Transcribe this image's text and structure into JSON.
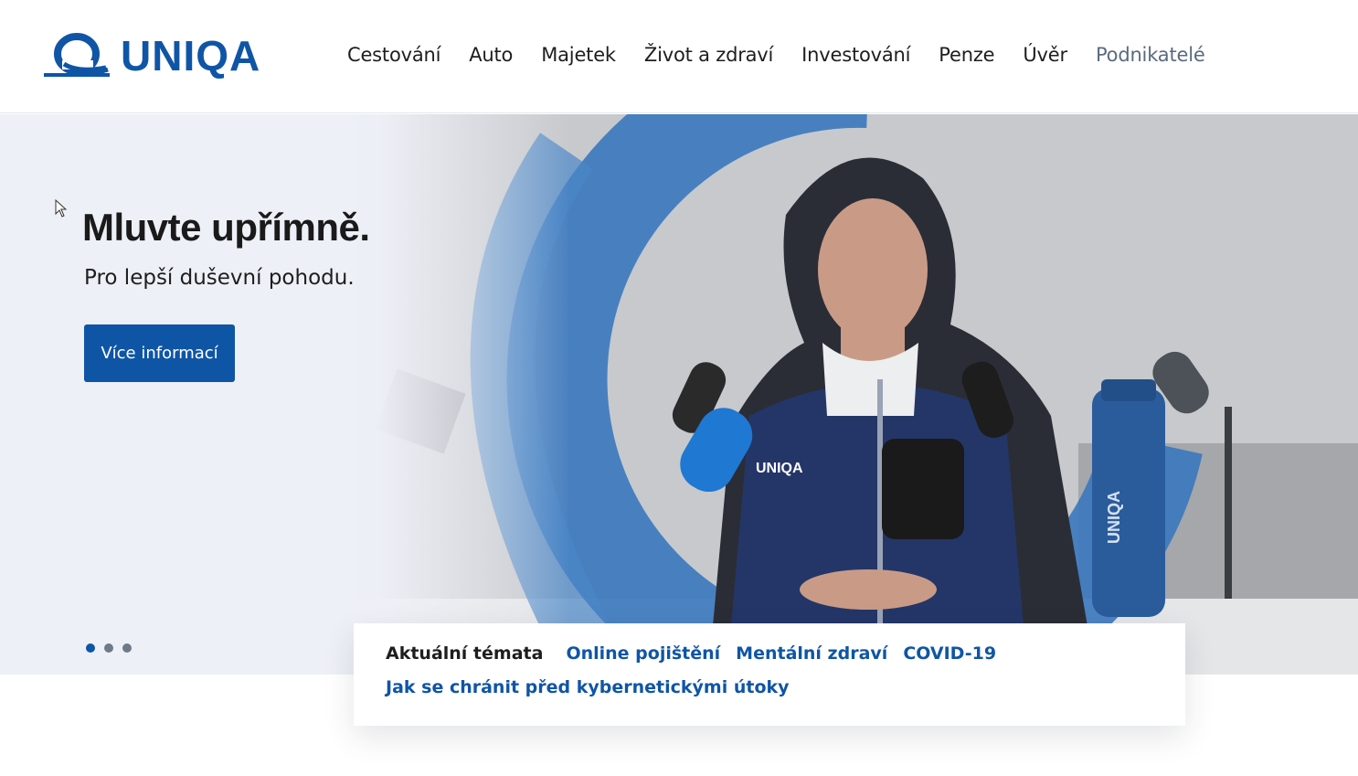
{
  "header": {
    "logo_text": "UNIQA",
    "nav": [
      {
        "label": "Cestování"
      },
      {
        "label": "Auto"
      },
      {
        "label": "Majetek"
      },
      {
        "label": "Život a zdraví"
      },
      {
        "label": "Investování"
      },
      {
        "label": "Penze"
      },
      {
        "label": "Úvěr"
      },
      {
        "label": "Podnikatelé"
      }
    ]
  },
  "hero": {
    "title": "Mluvte upřímně.",
    "subtitle": "Pro lepší duševní pohodu.",
    "button_label": "Více informací",
    "jacket_logo": "UNIQA",
    "bottle_logo": "UNIQA",
    "slides_total": 3,
    "active_slide": 1
  },
  "topics": {
    "label": "Aktuální témata",
    "links": [
      {
        "label": "Online pojištění"
      },
      {
        "label": "Mentální zdraví"
      },
      {
        "label": "COVID-19"
      },
      {
        "label": "Jak se chránit před kybernetickými útoky"
      }
    ]
  },
  "colors": {
    "brand_blue": "#0f55a6",
    "text_dark": "#1e1e1e",
    "nav_muted": "#5a6a80"
  }
}
